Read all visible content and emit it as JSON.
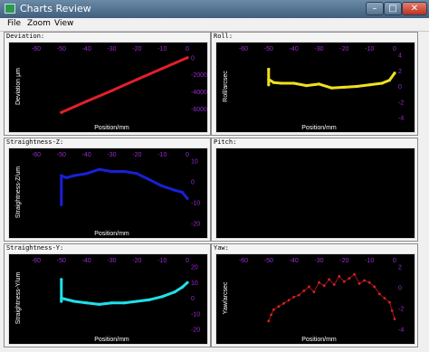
{
  "window": {
    "title": "Charts Review",
    "minimize": "–",
    "maximize": "□",
    "close": "✕"
  },
  "menu": {
    "file": "File",
    "zoom": "Zoom",
    "view": "View"
  },
  "panels": {
    "deviation": {
      "label": "Deviation:"
    },
    "roll": {
      "label": "Roll:"
    },
    "straightness_z": {
      "label": "Straightness-Z:"
    },
    "pitch": {
      "label": "Pitch:"
    },
    "straightness_y": {
      "label": "Straightness-Y:"
    },
    "yaw": {
      "label": "Yaw:"
    }
  },
  "colors": {
    "plot_bg": "#000000",
    "tick": "#9b2bd0",
    "axis_label": "#ffffff"
  },
  "chart_data": [
    {
      "id": "deviation",
      "type": "line",
      "color": "#e0202a",
      "xlabel": "Position/mm",
      "ylabel": "Deviation μm",
      "xlim": [
        -60,
        0
      ],
      "ylim": [
        -70000,
        3000
      ],
      "xticks": [
        -60,
        -50,
        -40,
        -30,
        -20,
        -10,
        0
      ],
      "yticks": [
        0,
        -20000,
        -40000,
        -60000
      ],
      "series": [
        {
          "x": [
            -50,
            -40,
            -30,
            -20,
            -10,
            0
          ],
          "y": [
            -64000,
            -51000,
            -38500,
            -25500,
            -12500,
            0
          ]
        }
      ]
    },
    {
      "id": "roll",
      "type": "line",
      "color": "#f0e020",
      "xlabel": "Position/mm",
      "ylabel": "Roll/arcsec",
      "xlim": [
        -60,
        0
      ],
      "ylim": [
        -4,
        4
      ],
      "xticks": [
        -60,
        -50,
        -40,
        -30,
        -20,
        -10,
        0
      ],
      "yticks": [
        4,
        2,
        0,
        -2,
        -4
      ],
      "series": [
        {
          "x": [
            -50,
            -50,
            -50,
            -48,
            -45,
            -40,
            -35,
            -30,
            -25,
            -20,
            -15,
            -10,
            -5,
            -2,
            0
          ],
          "y": [
            2.2,
            0.2,
            0.9,
            0.5,
            0.4,
            0.4,
            0.1,
            0.3,
            -0.2,
            -0.1,
            0,
            0.2,
            0.4,
            0.8,
            1.7
          ]
        }
      ]
    },
    {
      "id": "straightness_z",
      "type": "line",
      "color": "#1820d8",
      "xlabel": "Position/mm",
      "ylabel": "Straightness-Z/um",
      "xlim": [
        -60,
        0
      ],
      "ylim": [
        -20,
        10
      ],
      "xticks": [
        -60,
        -50,
        -40,
        -30,
        -20,
        -10,
        0
      ],
      "yticks": [
        10,
        0,
        -10,
        -20
      ],
      "series": [
        {
          "x": [
            -50,
            -50,
            -50,
            -48,
            -45,
            -40,
            -35,
            -30,
            -25,
            -20,
            -15,
            -10,
            -5,
            -2,
            0
          ],
          "y": [
            -4,
            -11,
            3,
            2,
            3,
            4,
            6,
            5,
            5,
            4,
            1,
            -2,
            -4,
            -5,
            -8
          ]
        }
      ]
    },
    {
      "id": "pitch",
      "type": "line",
      "series": []
    },
    {
      "id": "straightness_y",
      "type": "line",
      "color": "#20e0e8",
      "xlabel": "Position/mm",
      "ylabel": "Straightness-Y/um",
      "xlim": [
        -60,
        0
      ],
      "ylim": [
        -20,
        20
      ],
      "xticks": [
        -60,
        -50,
        -40,
        -30,
        -20,
        -10,
        0
      ],
      "yticks": [
        20,
        10,
        0,
        -10,
        -20
      ],
      "series": [
        {
          "x": [
            -50,
            -50,
            -50,
            -45,
            -40,
            -35,
            -30,
            -25,
            -20,
            -15,
            -10,
            -5,
            -2,
            0
          ],
          "y": [
            12,
            -2,
            0,
            -2,
            -3,
            -4,
            -3,
            -3,
            -2,
            -1,
            1,
            4,
            7,
            10
          ]
        }
      ]
    },
    {
      "id": "yaw",
      "type": "scatter",
      "color": "#e02020",
      "xlabel": "Position/mm",
      "ylabel": "Yaw/arcsec",
      "xlim": [
        -60,
        0
      ],
      "ylim": [
        -4,
        2
      ],
      "xticks": [
        -60,
        -50,
        -40,
        -30,
        -20,
        -10,
        0
      ],
      "yticks": [
        2,
        0,
        -2,
        -4
      ],
      "series": [
        {
          "x": [
            -50,
            -49,
            -48,
            -46,
            -44,
            -42,
            -40,
            -38,
            -36,
            -34,
            -32,
            -30,
            -28,
            -26,
            -24,
            -22,
            -20,
            -18,
            -16,
            -14,
            -12,
            -10,
            -8,
            -6,
            -4,
            -2,
            -1,
            0
          ],
          "y": [
            -3.2,
            -2.6,
            -2.1,
            -1.8,
            -1.5,
            -1.2,
            -0.9,
            -0.7,
            -0.3,
            0.1,
            -0.4,
            0.5,
            0.2,
            0.8,
            0.3,
            1.1,
            0.6,
            0.9,
            1.3,
            0.4,
            0.7,
            0.5,
            0.1,
            -0.6,
            -1.0,
            -1.4,
            -2.2,
            -3.0
          ]
        }
      ]
    }
  ]
}
